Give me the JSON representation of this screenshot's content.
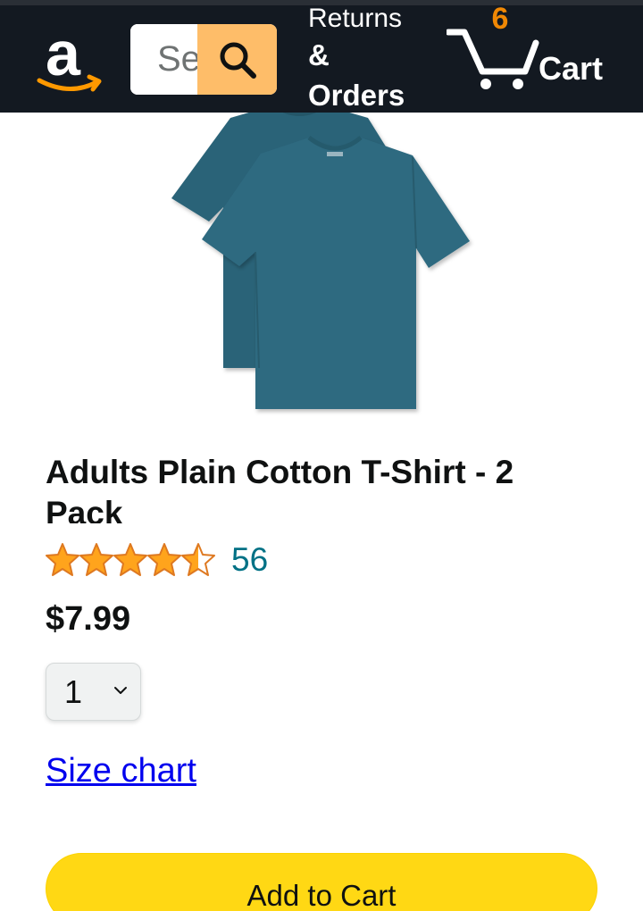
{
  "header": {
    "logo_icon": "amazon-logo-icon",
    "search": {
      "placeholder": "Search",
      "icon": "search-icon"
    },
    "returns": {
      "line1": "Returns",
      "line2": "&",
      "line3": "Orders"
    },
    "cart": {
      "count": "6",
      "label": "Cart",
      "icon": "cart-icon"
    }
  },
  "product": {
    "image_icon": "tshirt-image",
    "title": "Adults Plain Cotton T-Shirt - 2 Pack",
    "rating": {
      "stars": 4.5,
      "max": 5,
      "review_count": "56"
    },
    "price": "$7.99",
    "quantity": {
      "selected": "1"
    },
    "size_chart_label": "Size chart",
    "add_to_cart_label": "Add to Cart"
  },
  "colors": {
    "nav_bg": "#131921",
    "search_button": "#febd69",
    "cart_count": "#f08804",
    "star": "#ffa41c",
    "review_link": "#007185",
    "add_to_cart_bg": "#ffd814",
    "shirt": "#2f6a80"
  }
}
